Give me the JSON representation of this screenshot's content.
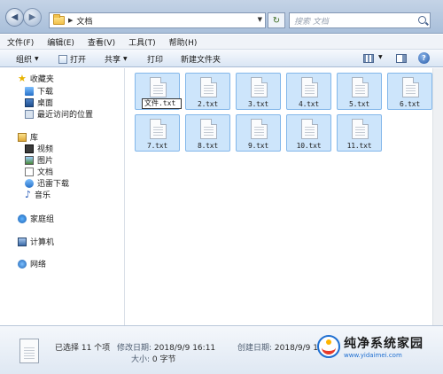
{
  "address": {
    "folder": "文档",
    "search_placeholder": "搜索 文档"
  },
  "menu": [
    "文件(F)",
    "编辑(E)",
    "查看(V)",
    "工具(T)",
    "帮助(H)"
  ],
  "commands": {
    "organize": "组织",
    "open": "打开",
    "share": "共享",
    "print": "打印",
    "new_folder": "新建文件夹"
  },
  "sidebar": {
    "favorites": "收藏夹",
    "downloads": "下载",
    "desktop": "桌面",
    "recent": "最近访问的位置",
    "libraries": "库",
    "videos": "视频",
    "pictures": "图片",
    "documents": "文档",
    "thunder": "迅雷下载",
    "music": "音乐",
    "homegroup": "家庭组",
    "computer": "计算机",
    "network": "网络"
  },
  "files": [
    {
      "name": "文件.txt",
      "rename": "文件.txt"
    },
    {
      "name": "2.txt"
    },
    {
      "name": "3.txt"
    },
    {
      "name": "4.txt"
    },
    {
      "name": "5.txt"
    },
    {
      "name": "6.txt"
    },
    {
      "name": "7.txt"
    },
    {
      "name": "8.txt"
    },
    {
      "name": "9.txt"
    },
    {
      "name": "10.txt"
    },
    {
      "name": "11.txt"
    }
  ],
  "details": {
    "selected": "已选择 11 个项",
    "modified_label": "修改日期:",
    "modified": "2018/9/9 16:11",
    "created_label": "创建日期:",
    "created": "2018/9/9 16",
    "size_label": "大小:",
    "size": "0 字节"
  },
  "watermark": {
    "title": "纯净系统家园",
    "url": "www.yidaimei.com"
  },
  "colors": {
    "selection": "#cde5fb",
    "selection_border": "#83b7ea"
  }
}
